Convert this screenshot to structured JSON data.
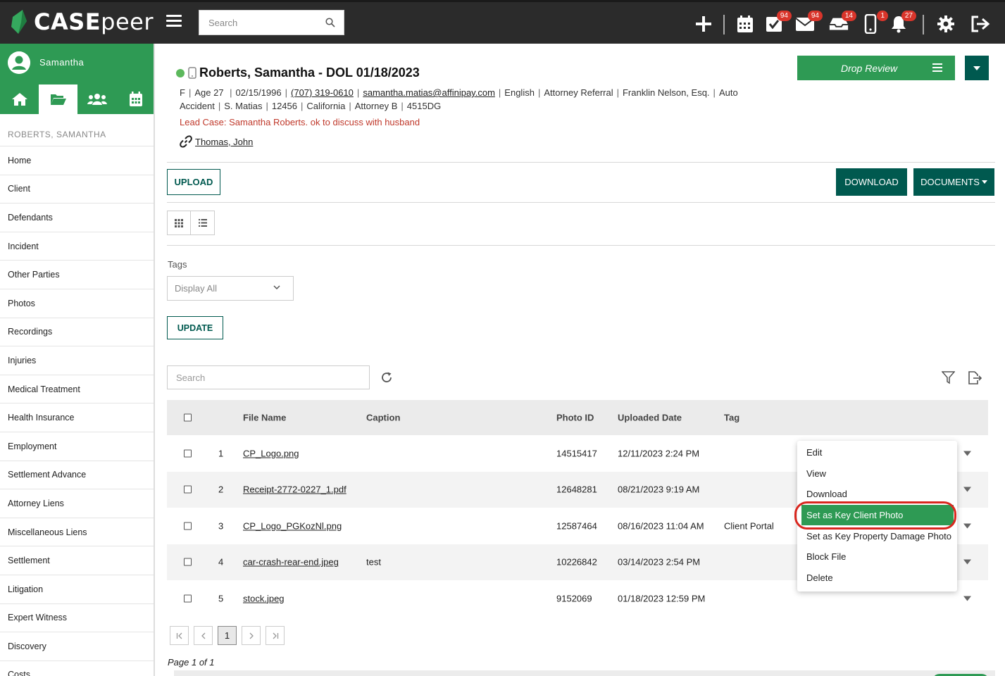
{
  "app": {
    "logo_text_bold": "CASE",
    "logo_text_light": "peer"
  },
  "topbar": {
    "search_placeholder": "Search",
    "badges": {
      "tasks": "94",
      "mail": "94",
      "inbox": "14",
      "phone": "1",
      "notifications": "27"
    }
  },
  "sidebar": {
    "user_name": "Samantha",
    "case_name": "ROBERTS, SAMANTHA",
    "items": [
      {
        "label": "Home"
      },
      {
        "label": "Client"
      },
      {
        "label": "Defendants"
      },
      {
        "label": "Incident"
      },
      {
        "label": "Other Parties"
      },
      {
        "label": "Photos"
      },
      {
        "label": "Recordings"
      },
      {
        "label": "Injuries"
      },
      {
        "label": "Medical Treatment"
      },
      {
        "label": "Health Insurance"
      },
      {
        "label": "Employment"
      },
      {
        "label": "Settlement Advance"
      },
      {
        "label": "Attorney Liens"
      },
      {
        "label": "Miscellaneous Liens"
      },
      {
        "label": "Settlement"
      },
      {
        "label": "Litigation"
      },
      {
        "label": "Expert Witness"
      },
      {
        "label": "Discovery"
      },
      {
        "label": "Costs"
      }
    ]
  },
  "case": {
    "title": "Roberts, Samantha - DOL 01/18/2023",
    "meta_line1": [
      "F",
      "Age 27",
      "02/15/1996"
    ],
    "phone": "(707) 319-0610",
    "email": "samantha.matias@affinipay.com",
    "meta_line1_tail": [
      "English",
      "Attorney Referral",
      "Franklin Nelson, Esq.",
      "Auto"
    ],
    "meta_line2": [
      "Accident",
      "S. Matias",
      "12456",
      "California",
      "Attorney B",
      "4515DG"
    ],
    "lead_note": "Lead Case: Samantha Roberts. ok to discuss with husband",
    "linked_case": "Thomas, John",
    "drop_review_label": "Drop Review"
  },
  "toolbar": {
    "upload_label": "UPLOAD",
    "download_label": "DOWNLOAD",
    "documents_label": "DOCUMENTS"
  },
  "filters": {
    "tags_label": "Tags",
    "tags_value": "Display All",
    "update_label": "UPDATE",
    "search_placeholder": "Search"
  },
  "table": {
    "headers": {
      "file_name": "File Name",
      "caption": "Caption",
      "photo_id": "Photo ID",
      "uploaded": "Uploaded Date",
      "tag": "Tag"
    },
    "rows": [
      {
        "num": "1",
        "file": "CP_Logo.png",
        "caption": "",
        "photo_id": "14515417",
        "uploaded": "12/11/2023 2:24 PM",
        "tag": ""
      },
      {
        "num": "2",
        "file": "Receipt-2772-0227_1.pdf",
        "caption": "",
        "photo_id": "12648281",
        "uploaded": "08/21/2023 9:19 AM",
        "tag": ""
      },
      {
        "num": "3",
        "file": "CP_Logo_PGKozNl.png",
        "caption": "",
        "photo_id": "12587464",
        "uploaded": "08/16/2023 11:04 AM",
        "tag": "Client Portal"
      },
      {
        "num": "4",
        "file": "car-crash-rear-end.jpeg",
        "caption": "test",
        "photo_id": "10226842",
        "uploaded": "03/14/2023 2:54 PM",
        "tag": ""
      },
      {
        "num": "5",
        "file": "stock.jpeg",
        "caption": "",
        "photo_id": "9152069",
        "uploaded": "01/18/2023 12:59 PM",
        "tag": ""
      }
    ]
  },
  "context_menu": {
    "items": [
      "Edit",
      "View",
      "Download",
      "Set as Key Client Photo",
      "Set as Key Property Damage Photo",
      "Block File",
      "Delete"
    ],
    "highlighted": "Set as Key Client Photo"
  },
  "pagination": {
    "current": "1",
    "page_text": "Page 1 of 1"
  },
  "colors": {
    "brand_green": "#2e9a54",
    "teal": "#00594f",
    "topbar": "#2b2b2b",
    "badge": "#d9352b",
    "highlight_ring": "#d9271f"
  }
}
